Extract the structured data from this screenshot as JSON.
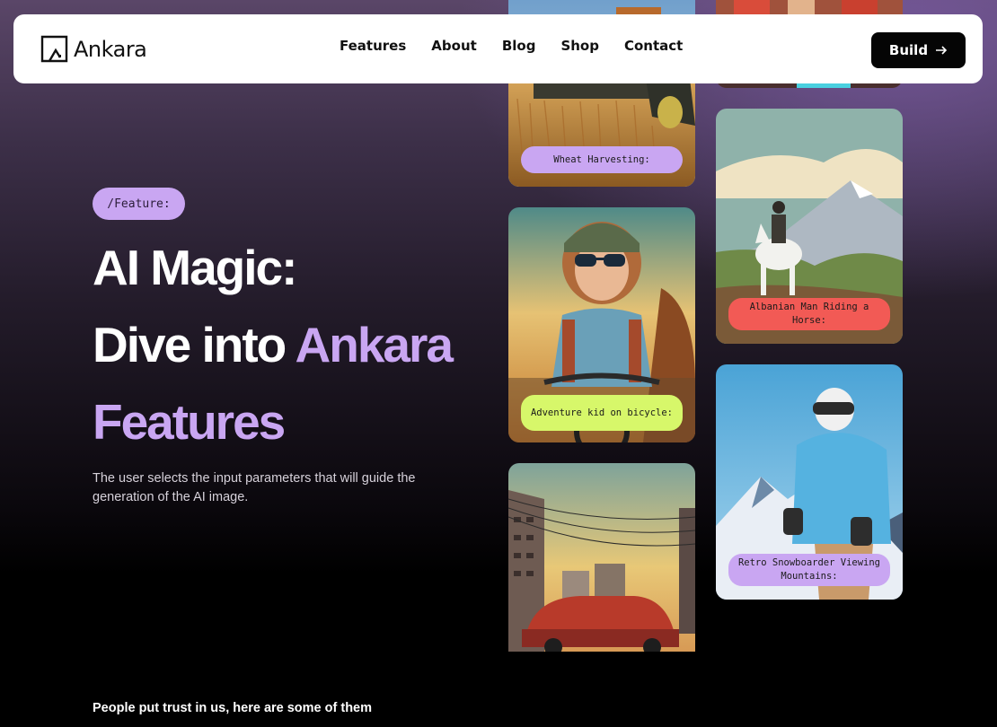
{
  "nav": {
    "brand": "Ankara",
    "links": [
      "Features",
      "About",
      "Blog",
      "Shop",
      "Contact"
    ],
    "cta_label": "Build",
    "cta_icon": "arrow-right-icon"
  },
  "hero": {
    "badge": "/Feature:",
    "title_line1": "AI Magic:",
    "title_line2_plain": "Dive into ",
    "title_line2_accent": "Ankara",
    "title_line3_accent": "Features",
    "description": "The user selects the input parameters that will guide the generation of the AI image.",
    "accent_color": "#c9a6f2"
  },
  "gallery": {
    "cards": [
      {
        "caption": ""
      },
      {
        "caption": ""
      },
      {
        "caption": "Wheat Harvesting:",
        "color": "#c9a6f2"
      },
      {
        "caption": "Adventure kid on bicycle:",
        "color": "#d7f76a"
      },
      {
        "caption": "",
        "color": ""
      },
      {
        "caption": "Albanian Man Riding a Horse:",
        "color": "#f25a55"
      },
      {
        "caption": "Retro Snowboarder Viewing Mountains:",
        "color": "#c9a6f2"
      }
    ]
  },
  "trust": {
    "text": "People put trust in us, here are some of them"
  }
}
